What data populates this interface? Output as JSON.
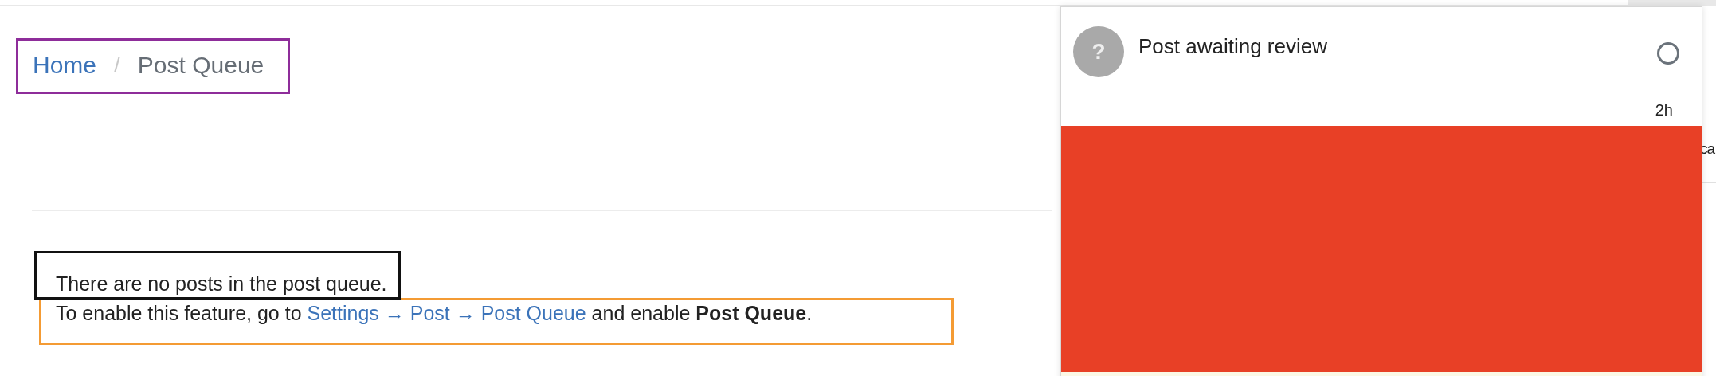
{
  "breadcrumb": [
    {
      "label": "Home",
      "kind": "link"
    },
    {
      "label": "Post Queue",
      "kind": "current"
    }
  ],
  "breadcrumb_separator": "/",
  "empty_message": "There are no posts in the post queue.",
  "hint": {
    "prefix": "To enable this feature, go to ",
    "link": "Settings → Post → Post Queue",
    "suffix": " and enable **Post Queue**."
  },
  "side_text": "ca",
  "notification": {
    "avatar": "?",
    "title": "Post awaiting review",
    "read": false,
    "time": "2h",
    "content": {
      "kind": "redacted",
      "color": "#e84026"
    }
  }
}
